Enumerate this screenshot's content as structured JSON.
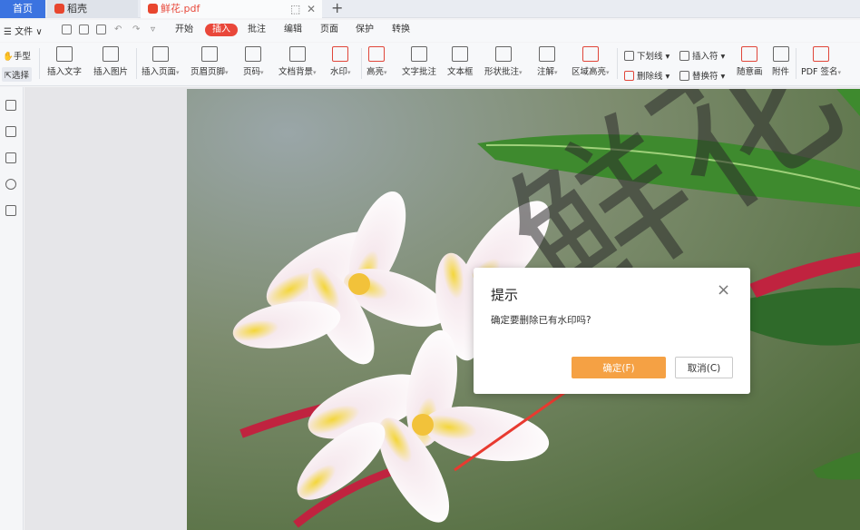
{
  "tabs": {
    "home": "首页",
    "daoke": "稻壳",
    "pdf": "鲜花.pdf"
  },
  "menu": {
    "file": "文件",
    "items": [
      "开始",
      "插入",
      "批注",
      "编辑",
      "页面",
      "保护",
      "转换"
    ],
    "active_index": 1
  },
  "ribbon": {
    "hand": "手型",
    "select": "选择",
    "tools": [
      "插入文字",
      "插入图片",
      "插入页面",
      "页眉页脚",
      "页码",
      "文档背景",
      "水印",
      "高亮",
      "文字批注",
      "文本框",
      "形状批注",
      "注解",
      "区域高亮"
    ],
    "underline": "下划线",
    "strikethrough": "删除线",
    "insert_mark": "插入符",
    "replace_mark": "替换符",
    "freehand": "随意画",
    "attachment": "附件",
    "pdf_sign": "PDF 签名"
  },
  "dialog": {
    "title": "提示",
    "message": "确定要删除已有水印吗?",
    "ok": "确定(F)",
    "cancel": "取消(C)"
  },
  "watermark_text": "鲜花",
  "colors": {
    "accent_blue": "#3b73e0",
    "accent_red": "#e9473a",
    "ok_orange": "#f5a144"
  }
}
